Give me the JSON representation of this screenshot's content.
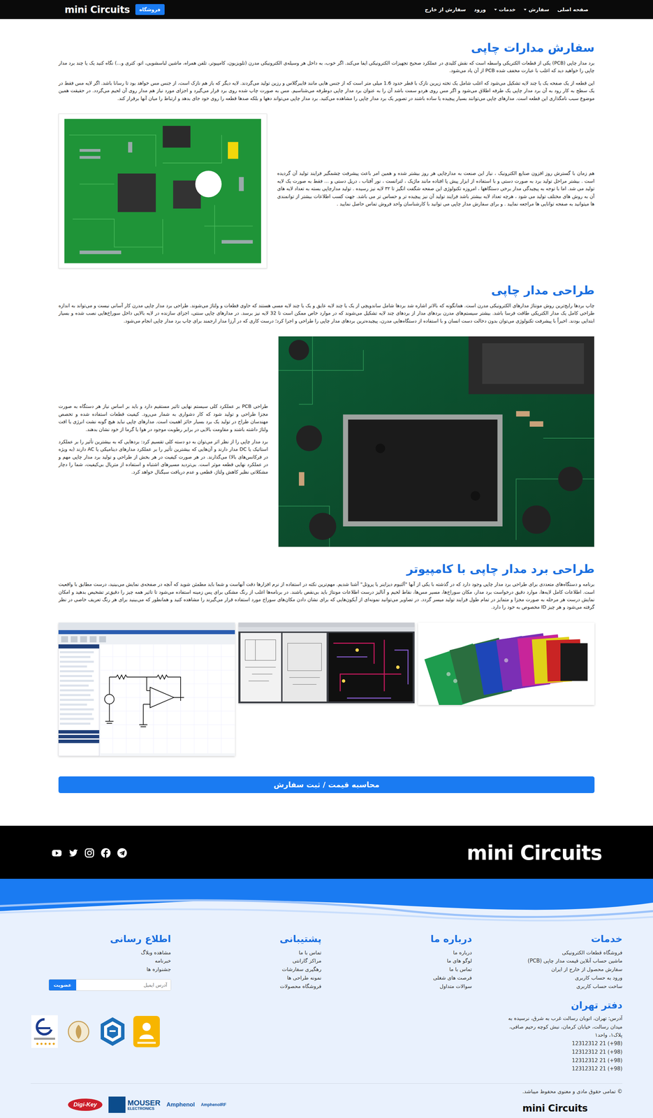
{
  "navbar": {
    "logo": "mini Circuits",
    "shop_button": "فروشگاه",
    "items": [
      {
        "label": "صفحه اصلی",
        "kind": "link"
      },
      {
        "label": "سفارش",
        "kind": "dropdown"
      },
      {
        "label": "خدمات",
        "kind": "dropdown"
      },
      {
        "label": "ورود",
        "kind": "link"
      },
      {
        "label": "سفارش از خارج",
        "kind": "link"
      }
    ]
  },
  "sections": [
    {
      "title": "سفارش مدارات چاپی",
      "paragraphs": [
        "برد مدار چاپی (PCB) یکی از قطعات الکتریکی واسطه است که نقش کلیدی در عملکرد صحیح تجهیزات الکترونیکی ایفا می‌کند. اگر خوب، به داخل هر وسیله‌ی الکترونیکی مدرن (تلویزیون، کامپیوتر، تلفن همراه، ماشین لباسشویی، اتو، کتری و...) نگاه کنید یک یا چند برد مدار چاپی را خواهید دید که اغلب با عبارت مخفف شده PCB از آن یاد می‌شود.",
        "این قطعه از یک صفحه یک یا چند لایه تشکیل می‌شود که اغلب شامل یک تخته زیرین نازک با قطر حدود 1.6 میلی متر است که از جنس هایی مانند فایبرگلاس و رزین تولید می‌گردند. لایه دیگر که باز هم نازک است، از جنس مس خواهد بود تا رسانا باشد. اگر لایه مس فقط در یک سطح به کار رود به آن برد مدار چاپی یک طرفه اطلاق می‌شود و اگر مس روی هردو سمت باشد آن را به عنوان برد مدار چاپی دوطرفه می‌شناسیم. مس به صورت چاپ شده روی برد قرار می‌گیرد و اجزای مورد نیاز هم مدار روی آن لحیم می‌گردد. در حقیقت همین موضوع سبب نامگذاری این قطعه است. مدارهای چاپی می‌توانند بسیار پیچیده یا ساده باشند در تصویر یک برد مدار چاپی را مشاهده می‌کنید. برد مدار چاپی می‌تواند دهها و بلکه صدها قطعه را روی خود جای بدهد و ارتباط را میان آنها برقرار کند."
      ],
      "side_paragraphs": [
        "هم زمان با گسترش روز افزون صنایع الکترونیک ، نیاز این صنعت به مدارچاپی هر روز بیشتر شده و همین امر باعث پیشرفت چشمگیر فرایند تولید آن گردیده است . بیشتر مراحل تولید برد به صورت دستی و با استفاده از ابزار پیش پا افتاده مانند ماژیک ، لترانست ، نور آفتاب ، دریل دستی و ... فقط به صورت یک لایه تولید می شد. اما با توجه به پیچیدگی مدار برخی دستگاهها ، امروزه تکنولوژی این صفحه شگفت انگیز تا ۳۲ لایه نیز رسیده . تولید مدارچاپی بسته به تعداد لایه های آن به روش های مختلف تولید می شود ، هرچه تعداد لایه بیشتر باشد فرایند تولید آن نیز پیچیده تر و حساس تر می باشد. جهت کسب اطلاعات بیشتر از توانمندی ها میتوانید به صفحه توانایی ها مراجعه نمایید . و برای سفارش مدار چاپی می توانید با کارشناسان واحد فروش تماس حاصل نمایید ."
      ]
    },
    {
      "title": "طراحی مدار چاپی",
      "paragraphs": [
        "چاپ بردها رایج‌ترین روش مونتاژ مدارهای الکترونیکی مدرن است. همانگونه که بالاتر اشاره شد بردها شامل ساندویچی از یک یا چند لایه عایق و یک یا چند لایه مسی هستند که حاوی قطعات و ولتاژ می‌شوند. طراحی برد مدار چاپی مدرن کار آسانی نیست و می‌تواند به اندازه طراحی کامل یک مدار الکتریکی طاقت فرسا باشد. بیشتر سیستم‌های مدرن بردهای مدار از بردهای چند لایه تشکیل می‌شوند که در موارد خاص ممکن است تا 32 لایه نیز برسد. در مدارهای چاپی سنتی، اجزای سازنده در لایه بالایی داخل سوراخ‌هایی نصب شده و بسیار ابتدایی بودند. اخیراً با پیشرفت تکنولوژی می‌توان بدون دخالت دست انسان و با استفاده از دستگاه‌هایی مدرن، پیچیده‌ترین بردهای مدار چاپی را طراحی و اجرا کرد؛ درست کاری که در آرزا مدار ارجمند برای چاپ برد مدار چاپی انجام می‌شود."
      ],
      "side_paragraphs": [
        "طراحی PCB بر عملکرد کلی سیستم نهایی تاثیر مستقیم دارد و باید بر اساس نیاز هر دستگاه به صورت مجزا طراحی و تولید شود که کار دشواری به شمار می‌رود. کیفیت قطعات استفاده شده و تخصص مهندسان طراح در تولید یک برد بسیار حائز اهمیت است. مدارهای چاپی نباید هیچ گونه نشت انرژی یا افت ولتاژ داشته باشند و مقاومت بالایی در برابر رطوبت موجود در هوا یا گرما از خود نشان بدهند.",
        "برد مدار چاپی را از نظر اثر می‌توان به دو دسته کلی تقسیم کرد: بردهایی که به بیشترین تأثیر را بر عملکرد استاتیک یا DC مدار دارند و آن‌هایی که بیشترین تأثیر را بر عملکرد مدارهای دینامیکی یا AC دارند (به ویژه در فرکانس‌های بالا) می‌گذارند. در هر صورت کیفیت در هر بخش از طراحی و تولید برد مدار چاپی مهم و در عملکرد نهایی قطعه موثر است. بی‌تردید مسیرهای اشتباه و استفاده از متریال بی‌کیفیت، شما را دچار مشکلاتی نظیر کاهش ولتاژ، قطعی و عدم دریافت سیگنال خواهد کرد."
      ]
    },
    {
      "title": "طراحی برد مدار چاپی با کامپیوتر",
      "paragraphs": [
        "برنامه و دستگاه‌های متعددی برای طراحی برد مدار چاپی وجود دارد که در گذشته با یکی از آنها \"آلتیوم دیزاینر یا پروتل\" آشنا شدیم. مهم‌ترین نکته در استفاده از نرم افزارها دقت آنهاست و شما باید مطمئن شوید که آنچه در صفحه‌ی نمایش می‌بینید، درست مطابق با واقعیت است. اطلاعات کامل لایه‌ها، موارد دقیق درخواست برد مدار، مکان سوراخ‌ها، مسیر مس‌ها، نقاط لحیم و آنالیز درست اطلاعات مونتاژ باید بی‌نقص باشند. در برنامه‌ها اغلب از رنگ مشکی برای پس زمینه استفاده می‌شود تا تاثیر همه چیز را دقیق‌تر تشخیص بدهید و امکان نمایش درست هر مرحله به صورت مجزا و متمایز در تمام طول فرایند تولید میسر گردد. در تصاویر می‌توانید نمونه‌ای از آیکون‌هایی که برای نشان دادن مکان‌های سوراخ مورد استفاده قرار می‌گیرند را مشاهده کنید و همانطور که می‌بینید برای هر رنگ تعریف خاصی در نظر گرفته می‌شود و هر چیز ID مخصوص به خود را دارد."
      ],
      "side_paragraphs": []
    }
  ],
  "cta_button": "محاسبه قیمت / ثبت سفارش",
  "footer": {
    "logo": "mini Circuits",
    "columns": [
      {
        "title": "خدمات",
        "items": [
          "فروشگاه قطعات الکترونیکی",
          "ماشین حساب آنلاین قیمت مدار چاپی (PCB)",
          "سفارش محصول از خارج از ایران",
          "ورود به حساب کاربری",
          "ساخت حساب کاربری"
        ]
      },
      {
        "title": "درباره ما",
        "items": [
          "درباره ما",
          "لوگو های ما",
          "تماس با ما",
          "فرصت های شغلی",
          "سوالات متداول"
        ]
      },
      {
        "title": "پشتیبانی",
        "items": [
          "تماس با ما",
          "مراکز گارانتی",
          "رهگیری سفارشات",
          "نمونه طراحی ها",
          "فروشگاه محصولات"
        ]
      },
      {
        "title": "اطلاع رسانی",
        "items": [
          "مشاهده وبلاگ",
          "خبرنامه",
          "جشنواره ها"
        ]
      }
    ],
    "newsletter": {
      "placeholder": "آدرس ایمیل",
      "button": "عضویت"
    },
    "office": {
      "title": "دفتر تهران",
      "address": "آدرس: تهران، اتوبان رسالت غرب به شرق، نرسیده به میدان رسالت، خیابان کرمان، نبش کوچه رحیم صافی، پلاک۱، واحد۱",
      "phones": [
        "(98+) 21 12312312",
        "(98+) 21 12312312",
        "(98+) 21 12312312",
        "(98+) 21 12312312"
      ]
    },
    "copyright": "© تمامی حقوق مادی و معنوی محفوظ میباشد.",
    "bottom_logo": "mini Circuits",
    "partners": [
      {
        "label": "Digi-Key",
        "kind": "digikey"
      },
      {
        "label": "MOUSER",
        "sub": "ELECTRONICS",
        "kind": "mouser"
      },
      {
        "label": "Amphenol",
        "kind": "amphenol"
      },
      {
        "label": "AmphenolRF",
        "kind": "amphenolrf"
      }
    ]
  }
}
